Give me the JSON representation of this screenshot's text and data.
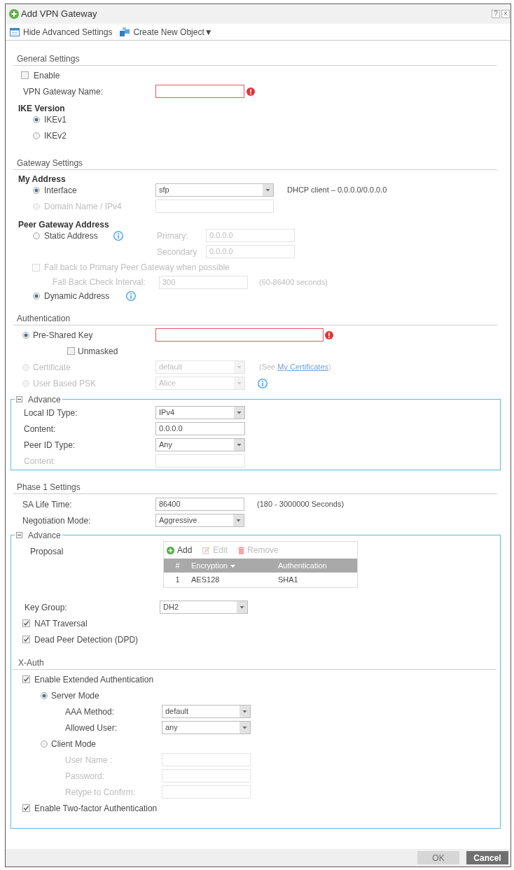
{
  "window": {
    "title": "Add VPN Gateway",
    "controls": [
      "?",
      "×"
    ]
  },
  "toolbar": [
    {
      "kind": "advanced_toggle",
      "label": "Hide Advanced Settings"
    },
    {
      "kind": "create_menu",
      "label": "Create New Object▼"
    }
  ],
  "general_settings": {
    "heading": "General Settings",
    "enable": {
      "label": "Enable",
      "checked": false
    },
    "gateway_name": {
      "label": "VPN Gateway Name:",
      "kind": "input",
      "invalid": true
    },
    "ike_version": {
      "heading": "IKE Version",
      "options": [
        {
          "label": "IKEv1",
          "selected": true
        },
        {
          "label": "IKEv2",
          "selected": false
        }
      ]
    }
  },
  "gateway_settings": {
    "heading": "Gateway Settings",
    "my_address": {
      "heading": "My Address",
      "options": [
        {
          "label": "Interface",
          "selected": true,
          "kind": "select",
          "value": "sfp",
          "disabled": false,
          "note": "DHCP client – 0.0.0.0/0.0.0.0"
        },
        {
          "label": "Domain Name / IPv4",
          "selected": false,
          "kind": "input",
          "disabled": true
        }
      ]
    },
    "peer_gateway_address": {
      "heading": "Peer Gateway Address",
      "static": {
        "label": "Static Address",
        "selected": false,
        "info": true,
        "addresses": [
          {
            "label": "Primary:",
            "kind": "input",
            "value": "0.0.0.0",
            "disabled": true
          },
          {
            "label": "Secondary",
            "kind": "input",
            "value": "0.0.0.0",
            "disabled": true
          }
        ]
      },
      "fall_back": {
        "label": "Fall back to Primary Peer Gateway when possible",
        "checked": false,
        "disabled": true,
        "interval": {
          "label": "Fall Back Check Interval:",
          "kind": "input",
          "value": "300",
          "disabled": true,
          "note": "(60-86400 seconds)"
        }
      },
      "dynamic": {
        "label": "Dynamic Address",
        "selected": true,
        "info": true
      }
    }
  },
  "authentication": {
    "heading": "Authentication",
    "methods": [
      {
        "label": "Pre-Shared Key",
        "selected": true,
        "kind": "input",
        "invalid": true,
        "disabled": false,
        "info": false,
        "unmasked": {
          "label": "Unmasked",
          "checked": false
        }
      },
      {
        "label": "Certificate",
        "selected": false,
        "kind": "select",
        "value": "default",
        "disabled": true,
        "info": false,
        "hint": {
          "prefix": "(See ",
          "link": "My Certificates",
          "suffix": ")"
        }
      },
      {
        "label": "User Based PSK",
        "selected": false,
        "kind": "select",
        "value": "Alice",
        "disabled": true,
        "info": true
      }
    ],
    "advance": {
      "label": "Advance",
      "expanded": true,
      "fields": [
        {
          "label": "Local ID Type:",
          "kind": "select",
          "value": "IPv4",
          "disabled": false
        },
        {
          "label": "Content:",
          "kind": "input",
          "value": "0.0.0.0",
          "disabled": false
        },
        {
          "label": "Peer ID Type:",
          "kind": "select",
          "value": "Any",
          "disabled": false
        },
        {
          "label": "Content:",
          "kind": "input",
          "disabled": true
        }
      ]
    }
  },
  "phase1_settings": {
    "heading": "Phase 1 Settings",
    "fields": [
      {
        "label": "SA Life Time:",
        "kind": "input",
        "value": "86400",
        "note": "(180 - 3000000 Seconds)"
      },
      {
        "label": "Negotiation Mode:",
        "kind": "select",
        "value": "Aggressive"
      }
    ],
    "advance": {
      "label": "Advance",
      "expanded": true,
      "proposal": {
        "label": "Proposal",
        "actions": [
          {
            "kind": "add",
            "label": "Add",
            "disabled": false
          },
          {
            "kind": "edit",
            "label": "Edit",
            "disabled": true
          },
          {
            "kind": "remove",
            "label": "Remove",
            "disabled": true
          }
        ],
        "columns": [
          {
            "label": "#",
            "sorted": false
          },
          {
            "label": "Encryption",
            "sorted": true
          },
          {
            "label": "Authentication",
            "sorted": false
          }
        ],
        "rows": [
          [
            "1",
            "AES128",
            "SHA1"
          ]
        ]
      },
      "key_group": {
        "label": "Key Group:",
        "kind": "select",
        "value": "DH2"
      },
      "options": [
        {
          "label": "NAT Traversal",
          "checked": true
        },
        {
          "label": "Dead Peer Detection (DPD)",
          "checked": true
        }
      ],
      "x_auth": {
        "heading": "X-Auth",
        "extended": {
          "label": "Enable Extended Authentication",
          "checked": true
        },
        "modes": [
          {
            "label": "Server Mode",
            "selected": true,
            "fields": [
              {
                "label": "AAA Method:",
                "kind": "select",
                "value": "default",
                "disabled": false
              },
              {
                "label": "Allowed User:",
                "kind": "select",
                "value": "any",
                "disabled": false
              }
            ]
          },
          {
            "label": "Client Mode",
            "selected": false,
            "fields": [
              {
                "label": "User Name :",
                "kind": "input",
                "disabled": true
              },
              {
                "label": "Password:",
                "kind": "input",
                "disabled": true
              },
              {
                "label": "Retype to Confirm:",
                "kind": "input",
                "disabled": true
              }
            ]
          }
        ],
        "two_factor": {
          "label": "Enable Two-factor Authentication",
          "checked": true
        }
      }
    }
  },
  "footer": {
    "buttons": [
      {
        "label": "OK",
        "disabled": true
      },
      {
        "label": "Cancel",
        "disabled": false
      }
    ]
  }
}
